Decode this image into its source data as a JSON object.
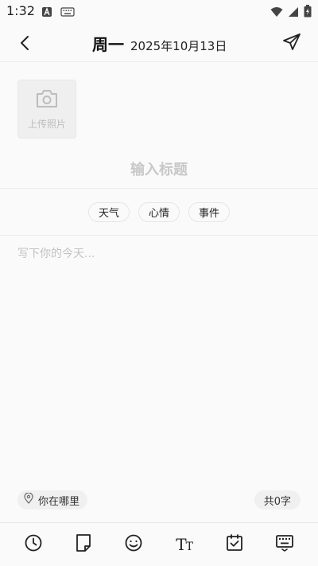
{
  "status_bar": {
    "time": "1:32",
    "icons": [
      "a-badge-icon",
      "keyboard-icon",
      "wifi-icon",
      "signal-icon",
      "battery-charging-icon"
    ]
  },
  "header": {
    "weekday": "周一",
    "date": "2025年10月13日",
    "icons": {
      "back": "chevron-left-icon",
      "send": "paper-plane-icon"
    }
  },
  "editor": {
    "upload_label": "上传照片",
    "title_placeholder": "输入标题",
    "tags": [
      "天气",
      "心情",
      "事件"
    ],
    "content_placeholder": "写下你的今天..."
  },
  "footer": {
    "location_label": "你在哪里",
    "word_count": "共0字"
  },
  "toolbar": {
    "items": [
      "clock-icon",
      "note-icon",
      "smiley-icon",
      "text-format-icon",
      "calendar-check-icon",
      "keyboard-icon"
    ],
    "text_format_glyph": "T",
    "text_format_glyph_small": "T"
  }
}
